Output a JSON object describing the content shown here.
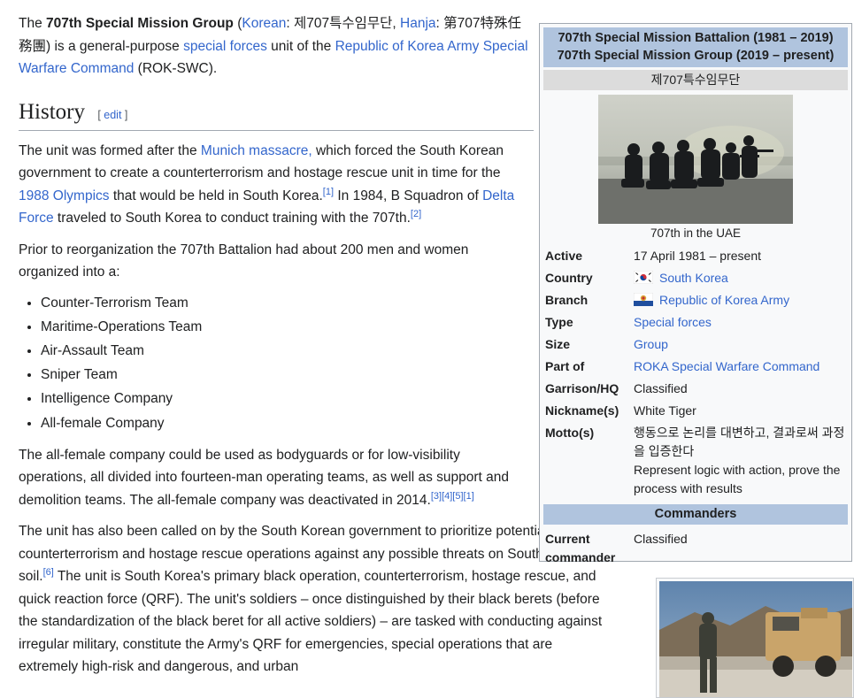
{
  "article": {
    "intro": {
      "t1": "The ",
      "name": "707th Special Mission Group",
      "t2": " (",
      "korean_link": "Korean",
      "t3": ": 제707특수임무단, ",
      "hanja_link": "Hanja",
      "t4": ": 第707特殊任務團) is a general-purpose ",
      "sf_link": "special forces",
      "t5": " unit of the ",
      "rok_link": "Republic of Korea Army Special Warfare Command",
      "t6": " (ROK-SWC)."
    },
    "history": {
      "heading": "History",
      "edit_open": "[ ",
      "edit_label": "edit",
      "edit_close": " ]"
    },
    "p1": {
      "t1": "The unit was formed after the ",
      "munich_link": "Munich massacre,",
      "t2": " which forced the South Korean government to create a counterterrorism and hostage rescue unit in time for the ",
      "olympics_link": "1988 Olympics",
      "t3": " that would be held in South Korea.",
      "ref1": "[1]",
      "t4": " In 1984, B Squadron of ",
      "delta_link": "Delta Force",
      "t5": " traveled to South Korea to conduct training with the 707th.",
      "ref2": "[2]"
    },
    "p2": "Prior to reorganization the 707th Battalion had about 200 men and women organized into a:",
    "teams": [
      "Counter-Terrorism Team",
      "Maritime-Operations Team",
      "Air-Assault Team",
      "Sniper Team",
      "Intelligence Company",
      "All-female Company"
    ],
    "p3": {
      "text": "The all-female company could be used as bodyguards or for low-visibility operations, all divided into fourteen-man operating teams, as well as support and demolition teams. The all-female company was deactivated in 2014.",
      "ref3": "[3]",
      "ref4": "[4]",
      "ref5": "[5]",
      "ref1": "[1]"
    },
    "p4": {
      "t1": "The unit has also been called on by the South Korean government to prioritize potential counterterrorism and hostage rescue operations against any possible threats on South Korean soil.",
      "ref6": "[6]",
      "t2": " The unit is South Korea's primary black operation, counterterrorism, hostage rescue, and quick reaction force (QRF). The unit's soldiers – once distinguished by their black berets (before the standardization of the black beret for all active soldiers) – are tasked with conducting against irregular military, constitute the Army's QRF for emergencies, special operations that are extremely high-risk and dangerous, and urban"
    }
  },
  "infobox": {
    "title_line1": "707th Special Mission Battalion (1981 – 2019)",
    "title_line2": "707th Special Mission Group (2019 – present)",
    "native_name": "제707특수임무단",
    "image_caption": "707th in the UAE",
    "rows": [
      {
        "label": "Active",
        "value": "17 April 1981 – present",
        "link": false
      },
      {
        "label": "Country",
        "value": "South Korea",
        "link": true,
        "flag": "south-korea-flag"
      },
      {
        "label": "Branch",
        "value": "Republic of Korea Army",
        "link": true,
        "flag": "roka-flag"
      },
      {
        "label": "Type",
        "value": "Special forces",
        "link": true
      },
      {
        "label": "Size",
        "value": "Group",
        "link": true
      },
      {
        "label": "Part of",
        "value": "ROKA Special Warfare Command",
        "link": true
      },
      {
        "label": "Garrison/HQ",
        "value": "Classified",
        "link": false
      },
      {
        "label": "Nickname(s)",
        "value": "White Tiger",
        "link": false
      }
    ],
    "motto_label": "Motto(s)",
    "motto_korean": "행동으로 논리를 대변하고, 결과로써 과정을 입증한다",
    "motto_english": "Represent logic with action, prove the process with results",
    "commanders_heading": "Commanders",
    "commander_label": "Current commander",
    "commander_value": "Classified"
  },
  "colors": {
    "link": "#3366cc",
    "text": "#202122",
    "infobox_header": "#b0c4de",
    "infobox_subheader": "#dcdcdc",
    "infobox_bg": "#f8f9fa"
  }
}
